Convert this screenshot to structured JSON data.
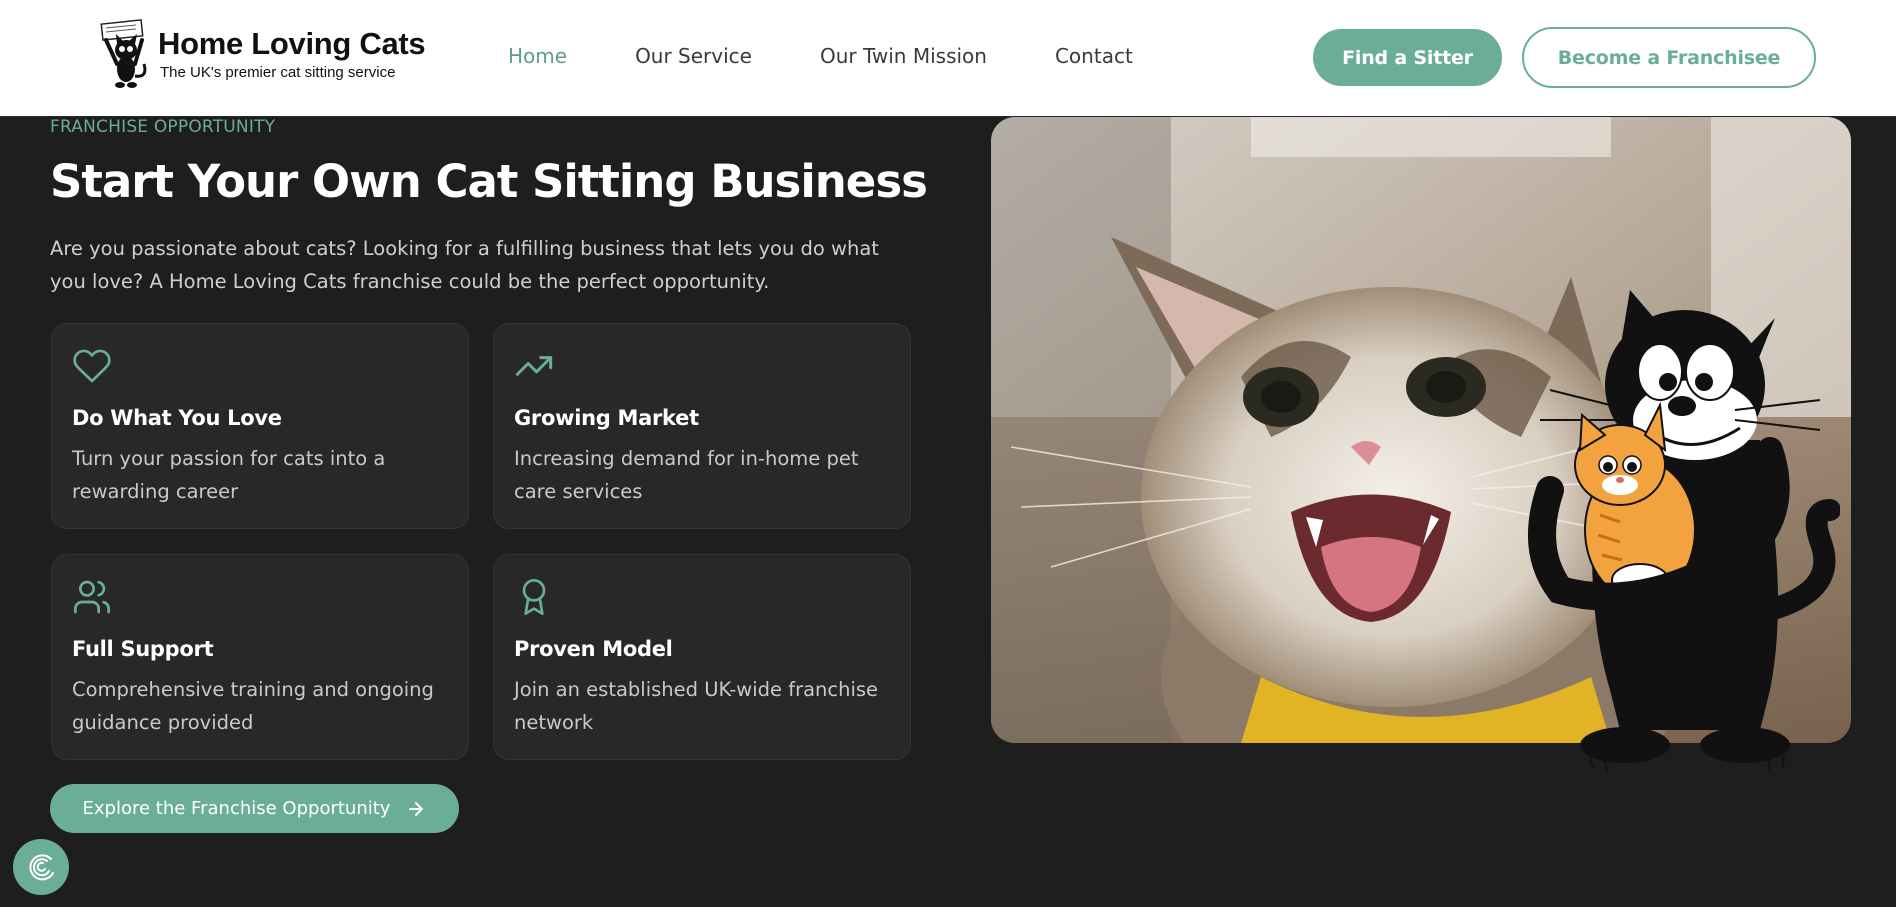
{
  "header": {
    "logo_title": "Home Loving Cats",
    "logo_tagline": "The UK's premier cat sitting service",
    "nav": [
      {
        "label": "Home",
        "active": true
      },
      {
        "label": "Our Service",
        "active": false
      },
      {
        "label": "Our Twin Mission",
        "active": false
      },
      {
        "label": "Contact",
        "active": false
      }
    ],
    "find_sitter_label": "Find a Sitter",
    "franchisee_label": "Become a Franchisee"
  },
  "hero": {
    "eyebrow": "FRANCHISE OPPORTUNITY",
    "headline": "Start Your Own Cat Sitting Business",
    "intro": "Are you passionate about cats? Looking for a fulfilling business that lets you do what you love? A Home Loving Cats franchise could be the perfect opportunity.",
    "cards": [
      {
        "icon": "heart-icon",
        "title": "Do What You Love",
        "desc": "Turn your passion for cats into a rewarding career"
      },
      {
        "icon": "trending-up-icon",
        "title": "Growing Market",
        "desc": "Increasing demand for in-home pet care services"
      },
      {
        "icon": "users-icon",
        "title": "Full Support",
        "desc": "Comprehensive training and ongoing guidance provided"
      },
      {
        "icon": "award-icon",
        "title": "Proven Model",
        "desc": "Join an established UK-wide franchise network"
      }
    ],
    "cta_label": "Explore the Franchise Opportunity"
  },
  "colors": {
    "accent": "#6aae95",
    "background": "#1e1e1e",
    "card": "#282828"
  }
}
